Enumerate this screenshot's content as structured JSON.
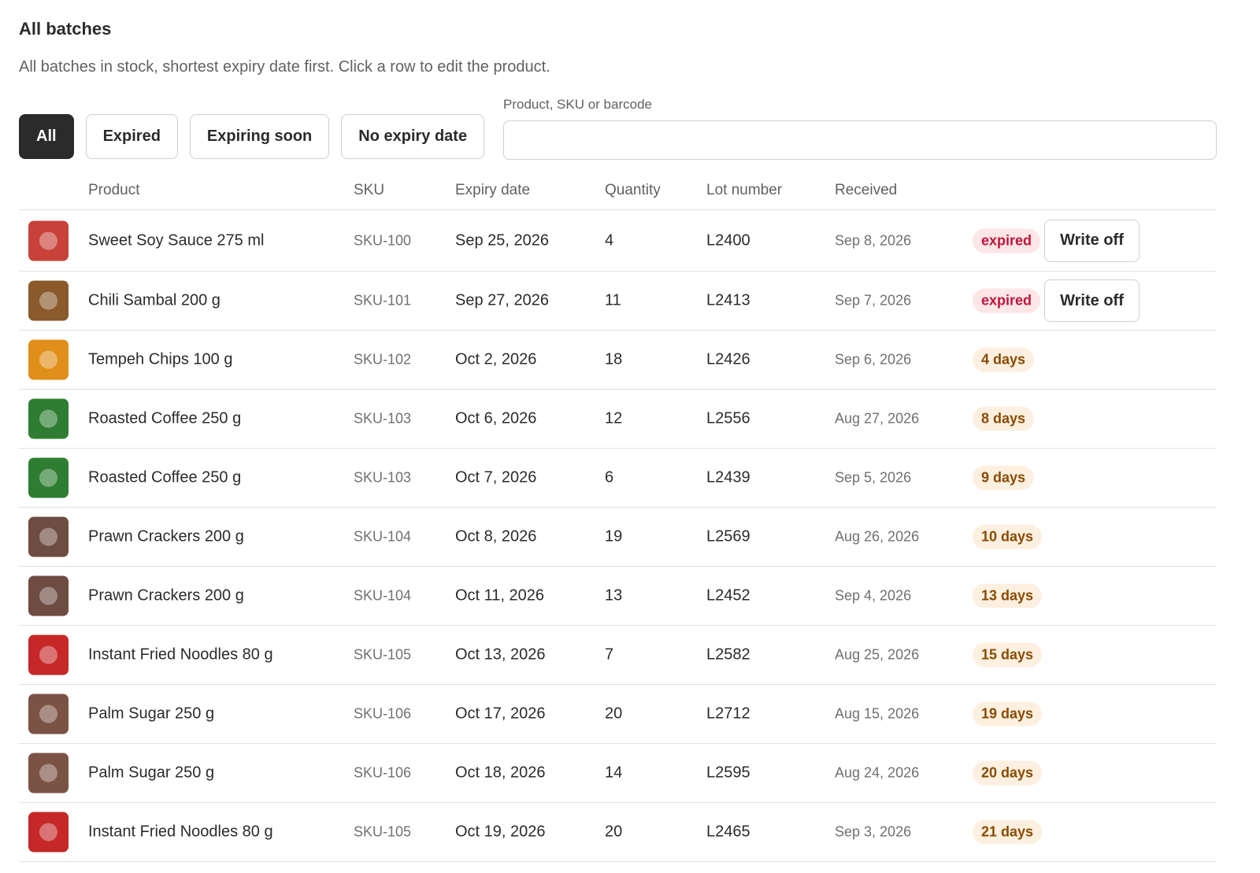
{
  "header": {
    "title": "All batches",
    "subtitle": "All batches in stock, shortest expiry date first. Click a row to edit the product."
  },
  "filters": [
    {
      "label": "All",
      "active": true
    },
    {
      "label": "Expired",
      "active": false
    },
    {
      "label": "Expiring soon",
      "active": false
    },
    {
      "label": "No expiry date",
      "active": false
    }
  ],
  "search": {
    "label": "Product, SKU or barcode",
    "value": "",
    "placeholder": ""
  },
  "columns": {
    "product": "Product",
    "sku": "SKU",
    "expiry": "Expiry date",
    "quantity": "Quantity",
    "lot": "Lot number",
    "received": "Received"
  },
  "write_off_label": "Write off",
  "colors": {
    "expired_badge_bg": "#fde6e6",
    "expired_badge_text": "#c0143c",
    "soon_badge_bg": "#fdf0e0",
    "soon_badge_text": "#8a4a00",
    "active_filter": "#2b2b2b"
  },
  "rows": [
    {
      "product": "Sweet Soy Sauce 275 ml",
      "sku": "SKU-100",
      "expiry": "Sep 25, 2026",
      "quantity": "4",
      "lot": "L2400",
      "received": "Sep 8, 2026",
      "status": "expired",
      "status_type": "expired",
      "write_off": true,
      "thumb_color": "#c8423a"
    },
    {
      "product": "Chili Sambal 200 g",
      "sku": "SKU-101",
      "expiry": "Sep 27, 2026",
      "quantity": "11",
      "lot": "L2413",
      "received": "Sep 7, 2026",
      "status": "expired",
      "status_type": "expired",
      "write_off": true,
      "thumb_color": "#8a5a2b"
    },
    {
      "product": "Tempeh Chips 100 g",
      "sku": "SKU-102",
      "expiry": "Oct 2, 2026",
      "quantity": "18",
      "lot": "L2426",
      "received": "Sep 6, 2026",
      "status": "4 days",
      "status_type": "soon",
      "write_off": false,
      "thumb_color": "#e08f1a"
    },
    {
      "product": "Roasted Coffee 250 g",
      "sku": "SKU-103",
      "expiry": "Oct 6, 2026",
      "quantity": "12",
      "lot": "L2556",
      "received": "Aug 27, 2026",
      "status": "8 days",
      "status_type": "soon",
      "write_off": false,
      "thumb_color": "#2f7d32"
    },
    {
      "product": "Roasted Coffee 250 g",
      "sku": "SKU-103",
      "expiry": "Oct 7, 2026",
      "quantity": "6",
      "lot": "L2439",
      "received": "Sep 5, 2026",
      "status": "9 days",
      "status_type": "soon",
      "write_off": false,
      "thumb_color": "#2f7d32"
    },
    {
      "product": "Prawn Crackers 200 g",
      "sku": "SKU-104",
      "expiry": "Oct 8, 2026",
      "quantity": "19",
      "lot": "L2569",
      "received": "Aug 26, 2026",
      "status": "10 days",
      "status_type": "soon",
      "write_off": false,
      "thumb_color": "#6d4c41"
    },
    {
      "product": "Prawn Crackers 200 g",
      "sku": "SKU-104",
      "expiry": "Oct 11, 2026",
      "quantity": "13",
      "lot": "L2452",
      "received": "Sep 4, 2026",
      "status": "13 days",
      "status_type": "soon",
      "write_off": false,
      "thumb_color": "#6d4c41"
    },
    {
      "product": "Instant Fried Noodles 80 g",
      "sku": "SKU-105",
      "expiry": "Oct 13, 2026",
      "quantity": "7",
      "lot": "L2582",
      "received": "Aug 25, 2026",
      "status": "15 days",
      "status_type": "soon",
      "write_off": false,
      "thumb_color": "#c62828"
    },
    {
      "product": "Palm Sugar 250 g",
      "sku": "SKU-106",
      "expiry": "Oct 17, 2026",
      "quantity": "20",
      "lot": "L2712",
      "received": "Aug 15, 2026",
      "status": "19 days",
      "status_type": "soon",
      "write_off": false,
      "thumb_color": "#7b5345"
    },
    {
      "product": "Palm Sugar 250 g",
      "sku": "SKU-106",
      "expiry": "Oct 18, 2026",
      "quantity": "14",
      "lot": "L2595",
      "received": "Aug 24, 2026",
      "status": "20 days",
      "status_type": "soon",
      "write_off": false,
      "thumb_color": "#7b5345"
    },
    {
      "product": "Instant Fried Noodles 80 g",
      "sku": "SKU-105",
      "expiry": "Oct 19, 2026",
      "quantity": "20",
      "lot": "L2465",
      "received": "Sep 3, 2026",
      "status": "21 days",
      "status_type": "soon",
      "write_off": false,
      "thumb_color": "#c62828"
    }
  ]
}
